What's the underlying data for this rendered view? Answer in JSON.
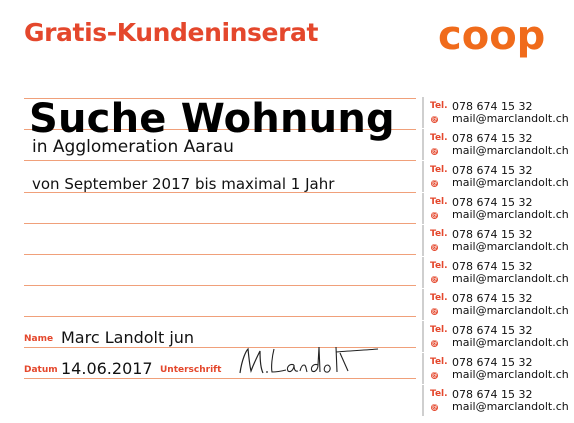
{
  "header": {
    "title": "Gratis-Kundeninserat",
    "logo_text": "coop"
  },
  "ad": {
    "headline": "Suche Wohnung",
    "subline": "in Agglomeration Aarau",
    "detail": "von September 2017 bis maximal 1 Jahr"
  },
  "form": {
    "name_label": "Name",
    "name_value": "Marc Landolt jun",
    "date_label": "Datum",
    "date_value": "14.06.2017",
    "signature_label": "Unterschrift",
    "signature_text": "M.Landolt"
  },
  "tabs": [
    {
      "tel_label": "Tel.",
      "phone": "078 674 15 32",
      "email_icon": "at-icon",
      "email": "mail@marclandolt.ch"
    },
    {
      "tel_label": "Tel.",
      "phone": "078 674 15 32",
      "email_icon": "at-icon",
      "email": "mail@marclandolt.ch"
    },
    {
      "tel_label": "Tel.",
      "phone": "078 674 15 32",
      "email_icon": "at-icon",
      "email": "mail@marclandolt.ch"
    },
    {
      "tel_label": "Tel.",
      "phone": "078 674 15 32",
      "email_icon": "at-icon",
      "email": "mail@marclandolt.ch"
    },
    {
      "tel_label": "Tel.",
      "phone": "078 674 15 32",
      "email_icon": "at-icon",
      "email": "mail@marclandolt.ch"
    },
    {
      "tel_label": "Tel.",
      "phone": "078 674 15 32",
      "email_icon": "at-icon",
      "email": "mail@marclandolt.ch"
    },
    {
      "tel_label": "Tel.",
      "phone": "078 674 15 32",
      "email_icon": "at-icon",
      "email": "mail@marclandolt.ch"
    },
    {
      "tel_label": "Tel.",
      "phone": "078 674 15 32",
      "email_icon": "at-icon",
      "email": "mail@marclandolt.ch"
    },
    {
      "tel_label": "Tel.",
      "phone": "078 674 15 32",
      "email_icon": "at-icon",
      "email": "mail@marclandolt.ch"
    },
    {
      "tel_label": "Tel.",
      "phone": "078 674 15 32",
      "email_icon": "at-icon",
      "email": "mail@marclandolt.ch"
    }
  ],
  "colors": {
    "accent": "#e4472c",
    "rule": "#f0a07a",
    "logo": "#f06b1b"
  }
}
